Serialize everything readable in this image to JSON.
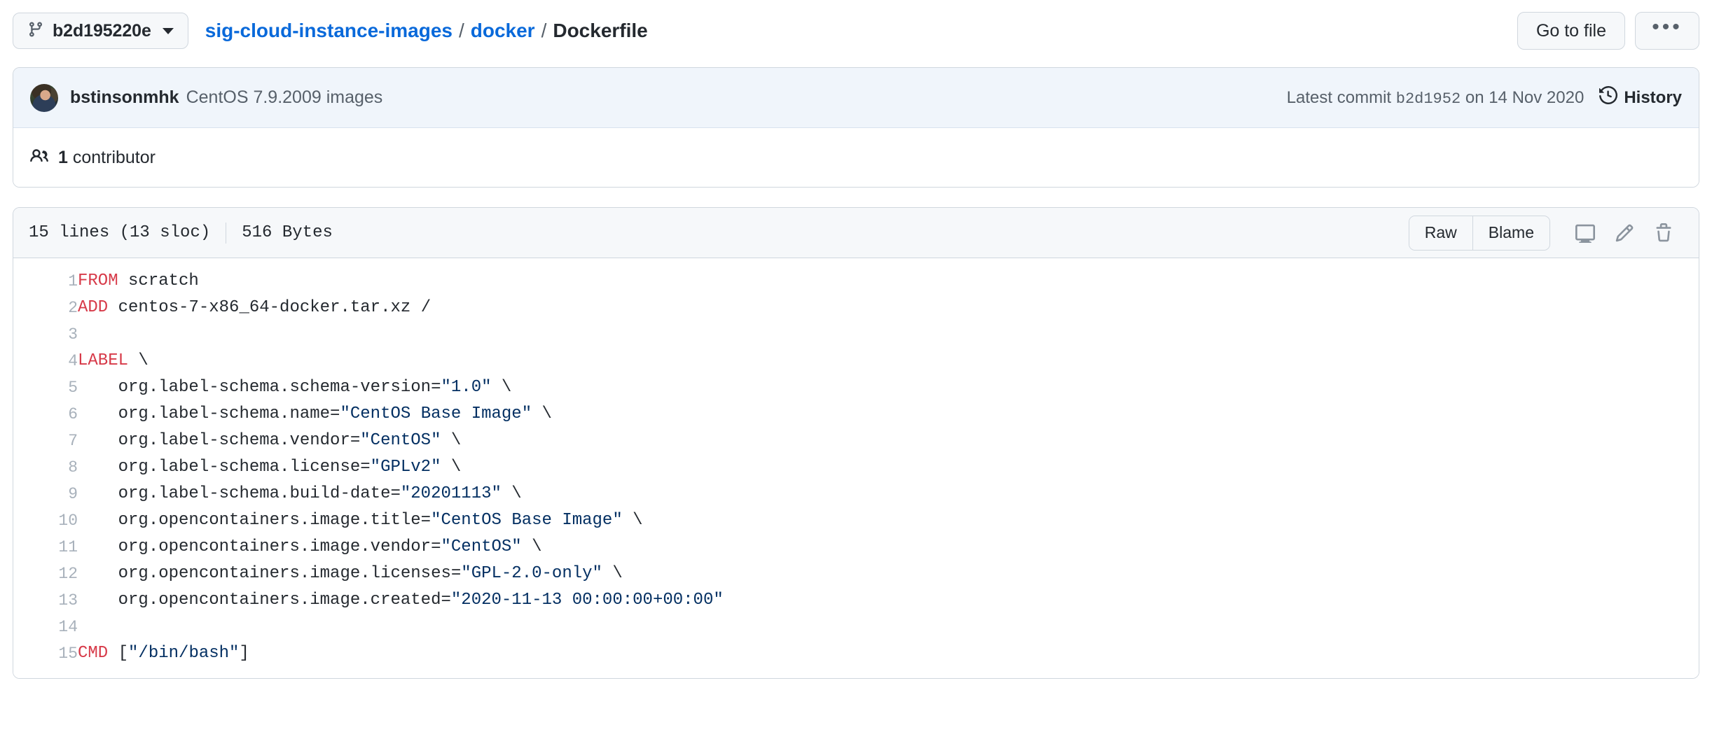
{
  "topbar": {
    "branch_icon": "git-branch-icon",
    "branch_label": "b2d195220e",
    "breadcrumb": {
      "repo": "sig-cloud-instance-images",
      "sep": "/",
      "folder": "docker",
      "file": "Dockerfile"
    },
    "go_to_file_label": "Go to file",
    "kebab_label": "•••"
  },
  "commit": {
    "avatar_name": "avatar",
    "author": "bstinsonmhk",
    "message": "CentOS 7.9.2009 images",
    "latest_prefix": "Latest commit",
    "sha": "b2d1952",
    "date_text": "on 14 Nov 2020",
    "history_label": "History",
    "history_icon": "history-clock-icon"
  },
  "contributors": {
    "icon": "people-icon",
    "count": "1",
    "label": "contributor",
    "text": "1 contributor"
  },
  "file_header": {
    "lines_text": "15 lines (13 sloc)",
    "size_text": "516 Bytes",
    "raw_label": "Raw",
    "blame_label": "Blame",
    "desktop_icon": "desktop-download-icon",
    "edit_icon": "pencil-icon",
    "delete_icon": "trash-icon"
  },
  "code": {
    "language": "dockerfile",
    "lines": [
      {
        "n": "1",
        "tokens": [
          {
            "t": "k",
            "v": "FROM"
          },
          {
            "t": "p",
            "v": " scratch"
          }
        ]
      },
      {
        "n": "2",
        "tokens": [
          {
            "t": "k",
            "v": "ADD"
          },
          {
            "t": "p",
            "v": " centos-7-x86_64-docker.tar.xz /"
          }
        ]
      },
      {
        "n": "3",
        "tokens": [
          {
            "t": "p",
            "v": ""
          }
        ]
      },
      {
        "n": "4",
        "tokens": [
          {
            "t": "k",
            "v": "LABEL"
          },
          {
            "t": "p",
            "v": " \\"
          }
        ]
      },
      {
        "n": "5",
        "tokens": [
          {
            "t": "p",
            "v": "    org.label-schema.schema-version="
          },
          {
            "t": "s",
            "v": "\"1.0\""
          },
          {
            "t": "p",
            "v": " \\"
          }
        ]
      },
      {
        "n": "6",
        "tokens": [
          {
            "t": "p",
            "v": "    org.label-schema.name="
          },
          {
            "t": "s",
            "v": "\"CentOS Base Image\""
          },
          {
            "t": "p",
            "v": " \\"
          }
        ]
      },
      {
        "n": "7",
        "tokens": [
          {
            "t": "p",
            "v": "    org.label-schema.vendor="
          },
          {
            "t": "s",
            "v": "\"CentOS\""
          },
          {
            "t": "p",
            "v": " \\"
          }
        ]
      },
      {
        "n": "8",
        "tokens": [
          {
            "t": "p",
            "v": "    org.label-schema.license="
          },
          {
            "t": "s",
            "v": "\"GPLv2\""
          },
          {
            "t": "p",
            "v": " \\"
          }
        ]
      },
      {
        "n": "9",
        "tokens": [
          {
            "t": "p",
            "v": "    org.label-schema.build-date="
          },
          {
            "t": "s",
            "v": "\"20201113\""
          },
          {
            "t": "p",
            "v": " \\"
          }
        ]
      },
      {
        "n": "10",
        "tokens": [
          {
            "t": "p",
            "v": "    org.opencontainers.image.title="
          },
          {
            "t": "s",
            "v": "\"CentOS Base Image\""
          },
          {
            "t": "p",
            "v": " \\"
          }
        ]
      },
      {
        "n": "11",
        "tokens": [
          {
            "t": "p",
            "v": "    org.opencontainers.image.vendor="
          },
          {
            "t": "s",
            "v": "\"CentOS\""
          },
          {
            "t": "p",
            "v": " \\"
          }
        ]
      },
      {
        "n": "12",
        "tokens": [
          {
            "t": "p",
            "v": "    org.opencontainers.image.licenses="
          },
          {
            "t": "s",
            "v": "\"GPL-2.0-only\""
          },
          {
            "t": "p",
            "v": " \\"
          }
        ]
      },
      {
        "n": "13",
        "tokens": [
          {
            "t": "p",
            "v": "    org.opencontainers.image.created="
          },
          {
            "t": "s",
            "v": "\"2020-11-13 00:00:00+00:00\""
          }
        ]
      },
      {
        "n": "14",
        "tokens": [
          {
            "t": "p",
            "v": ""
          }
        ]
      },
      {
        "n": "15",
        "tokens": [
          {
            "t": "k",
            "v": "CMD"
          },
          {
            "t": "p",
            "v": " ["
          },
          {
            "t": "s",
            "v": "\"/bin/bash\""
          },
          {
            "t": "p",
            "v": "]"
          }
        ]
      }
    ]
  },
  "colors": {
    "link": "#0969da",
    "text": "#24292f",
    "muted": "#57606a",
    "border": "#d0d7de",
    "grey_bg": "#f6f8fa",
    "commit_bg": "#f0f5fb",
    "keyword": "#d73a49",
    "string": "#032f62",
    "line_number": "#a8b1bb"
  }
}
